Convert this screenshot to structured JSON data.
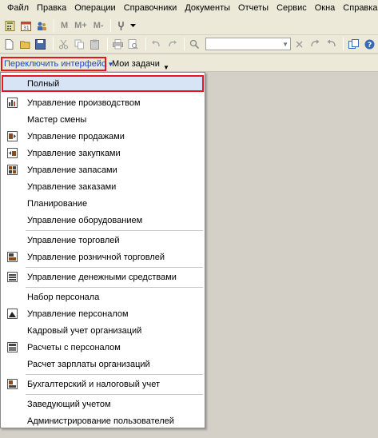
{
  "menubar": {
    "items": [
      "Файл",
      "Правка",
      "Операции",
      "Справочники",
      "Документы",
      "Отчеты",
      "Сервис",
      "Окна",
      "Справка"
    ]
  },
  "toolbar1": {
    "m_label": "M",
    "mplus_label": "M+",
    "mminus_label": "M-"
  },
  "panel": {
    "switch_label": "Переключить интерфейс",
    "tasks_label": "Мои задачи"
  },
  "dropdown": {
    "items": [
      {
        "label": "Полный",
        "icon": "none",
        "selected": true
      },
      {
        "label": "Управление производством",
        "icon": "production-icon"
      },
      {
        "label": "Мастер смены",
        "icon": "none"
      },
      {
        "label": "Управление продажами",
        "icon": "sales-icon"
      },
      {
        "label": "Управление закупками",
        "icon": "purchases-icon"
      },
      {
        "label": "Управление запасами",
        "icon": "inventory-icon"
      },
      {
        "label": "Управление заказами",
        "icon": "none"
      },
      {
        "label": "Планирование",
        "icon": "none"
      },
      {
        "label": "Управление оборудованием",
        "icon": "none"
      },
      {
        "label": "Управление торговлей",
        "icon": "none"
      },
      {
        "label": "Управление розничной торговлей",
        "icon": "retail-icon"
      },
      {
        "label": "Управление денежными средствами",
        "icon": "money-icon"
      },
      {
        "label": "Набор персонала",
        "icon": "none"
      },
      {
        "label": "Управление персоналом",
        "icon": "personnel-icon"
      },
      {
        "label": "Кадровый учет организаций",
        "icon": "none"
      },
      {
        "label": "Расчеты с персоналом",
        "icon": "payroll-icon"
      },
      {
        "label": "Расчет зарплаты организаций",
        "icon": "none"
      },
      {
        "label": "Бухгалтерский и налоговый учет",
        "icon": "accounting-icon"
      },
      {
        "label": "Заведующий учетом",
        "icon": "none"
      },
      {
        "label": "Администрирование пользователей",
        "icon": "none"
      }
    ]
  },
  "colors": {
    "highlight_border": "#e8141e",
    "link_blue": "#1a48c4",
    "selected_bg": "#d6e4f5"
  }
}
